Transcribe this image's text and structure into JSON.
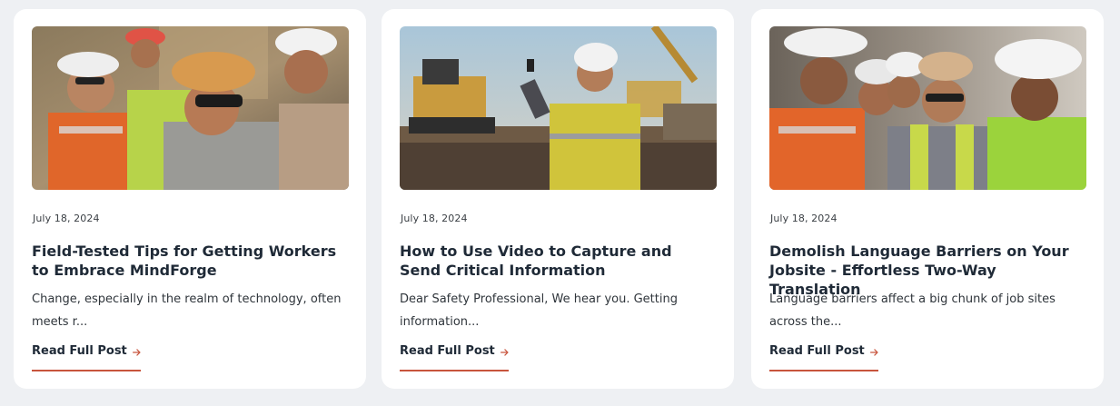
{
  "colors": {
    "page_background": "#eef0f3",
    "card_background": "#ffffff",
    "accent": "#c8553d",
    "title_text": "#1f2a37"
  },
  "posts": [
    {
      "image_icon": "construction-workers-photo",
      "date": "July 18, 2024",
      "title": "Field-Tested Tips for Getting Workers to Embrace MindForge",
      "excerpt": "Change, especially in the realm of technology, often meets r...",
      "cta_label": "Read Full Post",
      "cta_icon": "arrow-right-icon"
    },
    {
      "image_icon": "worker-filming-with-phone-photo",
      "date": "July 18, 2024",
      "title": "How to Use Video to Capture and Send Critical Information",
      "excerpt": "Dear Safety Professional, We hear you. Getting information...",
      "cta_label": "Read Full Post",
      "cta_icon": "arrow-right-icon"
    },
    {
      "image_icon": "worker-group-talking-photo",
      "date": "July 18, 2024",
      "title": "Demolish Language Barriers on Your Jobsite - Effortless Two-Way Translation",
      "excerpt": "Language barriers affect a big chunk of job sites across the...",
      "cta_label": "Read Full Post",
      "cta_icon": "arrow-right-icon"
    }
  ]
}
